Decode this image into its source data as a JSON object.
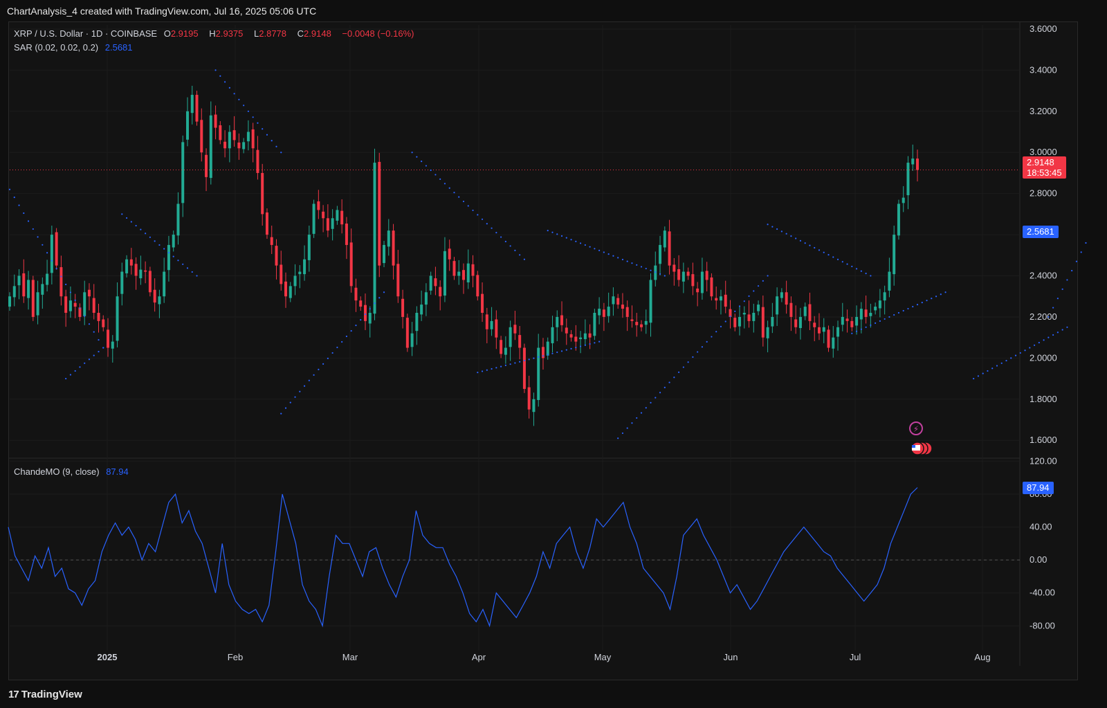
{
  "header": {
    "text": "ChartAnalysis_4 created with TradingView.com, Jul 16, 2025 05:06 UTC"
  },
  "legend": {
    "symbol": "XRP / U.S. Dollar · 1D · COINBASE",
    "o_label": "O",
    "o_value": "2.9195",
    "h_label": "H",
    "h_value": "2.9375",
    "l_label": "L",
    "l_value": "2.8778",
    "c_label": "C",
    "c_value": "2.9148",
    "change": "−0.0048 (−0.16%)",
    "sar_label": "SAR (0.02, 0.02, 0.2)",
    "sar_value": "2.5681",
    "cmo_label": "ChandeMO (9, close)",
    "cmo_value": "87.94"
  },
  "price_tag": {
    "value": "2.9148",
    "countdown": "18:53:45"
  },
  "sar_tag": {
    "value": "2.5681"
  },
  "cmo_tag": {
    "value": "87.94"
  },
  "footer": {
    "brand": "TradingView",
    "logo": "17"
  },
  "colors": {
    "up": "#22ab94",
    "down": "#f23645",
    "sar": "#2962ff",
    "cmo": "#2962ff"
  },
  "chart_data": {
    "type": "candlestick",
    "price_axis": {
      "ticks": [
        "3.6000",
        "3.4000",
        "3.2000",
        "3.0000",
        "2.8000",
        "2.6000",
        "2.4000",
        "2.2000",
        "2.0000",
        "1.8000",
        "1.6000"
      ],
      "ylim": [
        1.52,
        3.62
      ]
    },
    "cmo_axis": {
      "ticks": [
        "120.00",
        "80.00",
        "40.00",
        "0.00",
        "-40.00",
        "-80.00"
      ],
      "ylim": [
        -110,
        122
      ]
    },
    "time_axis": {
      "labels": [
        "2025",
        "Feb",
        "Mar",
        "Apr",
        "May",
        "Jun",
        "Jul",
        "Aug"
      ]
    },
    "close": [
      2.3,
      2.35,
      2.4,
      2.3,
      2.38,
      2.2,
      2.32,
      2.36,
      2.41,
      2.6,
      2.45,
      2.3,
      2.22,
      2.28,
      2.25,
      2.2,
      2.32,
      2.3,
      2.22,
      2.18,
      2.15,
      2.05,
      2.08,
      2.3,
      2.42,
      2.48,
      2.45,
      2.4,
      2.43,
      2.42,
      2.32,
      2.27,
      2.3,
      2.42,
      2.55,
      2.6,
      2.75,
      3.05,
      3.2,
      3.28,
      3.15,
      3.0,
      2.88,
      3.18,
      3.12,
      3.06,
      3.02,
      3.1,
      3.06,
      3.02,
      3.05,
      3.1,
      3.02,
      2.9,
      2.7,
      2.6,
      2.55,
      2.45,
      2.36,
      2.3,
      2.35,
      2.4,
      2.42,
      2.48,
      2.6,
      2.75,
      2.72,
      2.68,
      2.62,
      2.68,
      2.72,
      2.65,
      2.55,
      2.35,
      2.28,
      2.25,
      2.18,
      2.22,
      2.95,
      2.45,
      2.55,
      2.62,
      2.45,
      2.3,
      2.2,
      2.05,
      2.12,
      2.22,
      2.26,
      2.32,
      2.4,
      2.35,
      2.3,
      2.52,
      2.48,
      2.4,
      2.42,
      2.38,
      2.46,
      2.4,
      2.3,
      2.22,
      2.14,
      2.18,
      2.1,
      2.02,
      2.05,
      2.15,
      2.12,
      2.05,
      1.85,
      1.75,
      1.8,
      2.05,
      2.0,
      2.08,
      2.15,
      2.2,
      2.16,
      2.12,
      2.1,
      2.08,
      2.1,
      2.12,
      2.1,
      2.22,
      2.24,
      2.2,
      2.25,
      2.3,
      2.26,
      2.24,
      2.2,
      2.18,
      2.16,
      2.15,
      2.18,
      2.38,
      2.45,
      2.55,
      2.62,
      2.45,
      2.42,
      2.38,
      2.42,
      2.4,
      2.35,
      2.32,
      2.42,
      2.38,
      2.3,
      2.28,
      2.3,
      2.25,
      2.2,
      2.15,
      2.2,
      2.22,
      2.18,
      2.22,
      2.26,
      2.1,
      2.15,
      2.2,
      2.3,
      2.32,
      2.26,
      2.2,
      2.15,
      2.2,
      2.25,
      2.18,
      2.15,
      2.12,
      2.15,
      2.05,
      2.1,
      2.15,
      2.2,
      2.18,
      2.15,
      2.2,
      2.24,
      2.2,
      2.22,
      2.25,
      2.28,
      2.32,
      2.42,
      2.6,
      2.75,
      2.78,
      2.95,
      2.97,
      2.9148
    ],
    "sar": [
      {
        "from": 0,
        "to": 20,
        "a": 2.82,
        "b": 2.05
      },
      {
        "from": 24,
        "to": 40,
        "a": 2.7,
        "b": 2.4
      },
      {
        "from": 12,
        "to": 20,
        "a": 1.9,
        "b": 2.05
      },
      {
        "from": 44,
        "to": 58,
        "a": 3.4,
        "b": 3.0
      },
      {
        "from": 58,
        "to": 80,
        "a": 1.73,
        "b": 2.32
      },
      {
        "from": 86,
        "to": 110,
        "a": 3.0,
        "b": 2.48
      },
      {
        "from": 100,
        "to": 126,
        "a": 1.93,
        "b": 2.08
      },
      {
        "from": 115,
        "to": 140,
        "a": 2.62,
        "b": 2.4
      },
      {
        "from": 130,
        "to": 162,
        "a": 1.61,
        "b": 2.4
      },
      {
        "from": 162,
        "to": 184,
        "a": 2.65,
        "b": 2.4
      },
      {
        "from": 180,
        "to": 200,
        "a": 2.12,
        "b": 2.32
      },
      {
        "from": 206,
        "to": 226,
        "a": 1.9,
        "b": 2.15
      },
      {
        "from": 222,
        "to": 230,
        "a": 2.2,
        "b": 2.56
      }
    ],
    "cmo": [
      40,
      5,
      -10,
      -25,
      5,
      -10,
      15,
      -20,
      -10,
      -35,
      -40,
      -55,
      -35,
      -25,
      10,
      30,
      45,
      30,
      40,
      25,
      0,
      20,
      10,
      40,
      70,
      80,
      45,
      60,
      35,
      20,
      -10,
      -40,
      20,
      -30,
      -50,
      -60,
      -65,
      -60,
      -75,
      -55,
      10,
      80,
      50,
      20,
      -30,
      -50,
      -60,
      -80,
      -20,
      30,
      20,
      20,
      0,
      -20,
      10,
      15,
      -10,
      -30,
      -45,
      -20,
      0,
      60,
      30,
      20,
      15,
      15,
      -5,
      -20,
      -40,
      -65,
      -75,
      -60,
      -80,
      -40,
      -50,
      -60,
      -70,
      -55,
      -40,
      -20,
      10,
      -10,
      20,
      30,
      40,
      10,
      -10,
      15,
      50,
      40,
      50,
      60,
      70,
      40,
      20,
      -10,
      -20,
      -30,
      -40,
      -60,
      -20,
      30,
      40,
      50,
      30,
      15,
      0,
      -20,
      -40,
      -30,
      -45,
      -60,
      -50,
      -35,
      -20,
      -5,
      10,
      20,
      30,
      40,
      30,
      20,
      10,
      5,
      -10,
      -20,
      -30,
      -40,
      -50,
      -40,
      -30,
      -10,
      20,
      40,
      60,
      80,
      87.94
    ],
    "series": [
      {
        "name": "XRP / U.S. Dollar"
      },
      {
        "name": "SAR (0.02, 0.02, 0.2)"
      },
      {
        "name": "ChandeMO (9, close)"
      }
    ]
  }
}
